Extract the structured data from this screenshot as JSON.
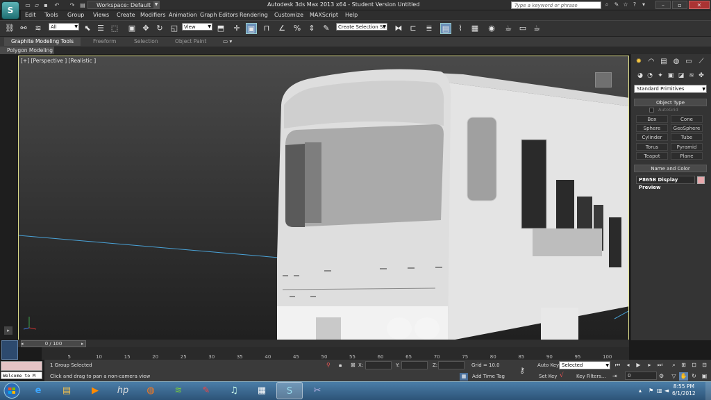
{
  "window": {
    "app_title": "Autodesk 3ds Max  2013 x64  -  Student Version   Untitled",
    "workspace": "Workspace: Default",
    "search_placeholder": "Type a keyword or phrase",
    "logo_letter": "S"
  },
  "menu": [
    "Edit",
    "Tools",
    "Group",
    "Views",
    "Create",
    "Modifiers",
    "Animation",
    "Graph Editors",
    "Rendering",
    "Customize",
    "MAXScript",
    "Help"
  ],
  "toolbar": {
    "filter": "All",
    "view": "View",
    "selection_set": "Create Selection Se"
  },
  "ribbon": {
    "tabs": [
      "Graphite Modeling Tools",
      "Freeform",
      "Selection",
      "Object Paint"
    ],
    "panel": "Polygon Modeling"
  },
  "viewport": {
    "label": "[+] [Perspective ] [Realistic ]"
  },
  "command_panel": {
    "category": "Standard Primitives",
    "object_type_title": "Object Type",
    "autogrid": "AutoGrid",
    "primitives": [
      "Box",
      "Cone",
      "Sphere",
      "GeoSphere",
      "Cylinder",
      "Tube",
      "Torus",
      "Pyramid",
      "Teapot",
      "Plane"
    ],
    "name_color_title": "Name and Color",
    "object_name": "P865B Display Preview",
    "object_color": "#e7a8ac"
  },
  "timeline": {
    "slider": "0 / 100",
    "ticks": [
      "0",
      "5",
      "10",
      "15",
      "20",
      "25",
      "30",
      "35",
      "40",
      "45",
      "50",
      "55",
      "60",
      "65",
      "70",
      "75",
      "80",
      "85",
      "90",
      "95",
      "100"
    ]
  },
  "status": {
    "selection": "1 Group Selected",
    "prompt": "Click and drag to pan a non-camera view",
    "listener": "Welcome to M",
    "x_label": "X:",
    "y_label": "Y:",
    "z_label": "Z:",
    "grid": "Grid = 10.0",
    "add_time_tag": "Add Time Tag",
    "auto_key": "Auto Key",
    "set_key": "Set Key",
    "selected": "Selected",
    "key_filters": "Key Filters...",
    "frame": "0"
  },
  "taskbar": {
    "time": "8:55 PM",
    "date": "6/1/2012"
  }
}
